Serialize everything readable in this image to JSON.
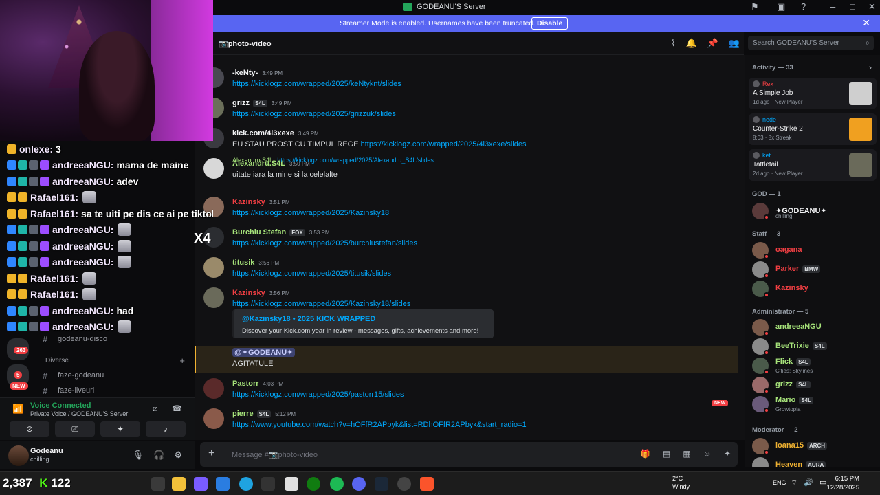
{
  "window": {
    "server_title": "GODEANU'S Server"
  },
  "banner": {
    "text": "Streamer Mode is enabled. Usernames have been truncated.",
    "button": "Disable"
  },
  "channel": {
    "name": "📷photo-video"
  },
  "search": {
    "placeholder": "Search GODEANU'S Server"
  },
  "stream_chat": [
    {
      "user": "onlexe:",
      "text": "3",
      "badges": [
        "gold"
      ]
    },
    {
      "user": "andreeaNGU:",
      "text": "mama de maine",
      "badges": [
        "blue",
        "teal",
        "grey",
        "purple"
      ]
    },
    {
      "user": "andreeaNGU:",
      "text": "adev",
      "badges": [
        "blue",
        "teal",
        "grey",
        "purple"
      ]
    },
    {
      "user": "Rafael161:",
      "text": "",
      "badges": [
        "gold",
        "gold"
      ],
      "emote": true
    },
    {
      "user": "Rafael161:",
      "text": "sa te uiti pe dis ce ai pe tiktoks",
      "badges": [
        "gold",
        "gold"
      ]
    },
    {
      "user": "andreeaNGU:",
      "text": "",
      "badges": [
        "blue",
        "teal",
        "grey",
        "purple"
      ],
      "emote": true
    },
    {
      "user": "andreeaNGU:",
      "text": "",
      "badges": [
        "blue",
        "teal",
        "grey",
        "purple"
      ],
      "emote": true
    },
    {
      "user": "andreeaNGU:",
      "text": "",
      "badges": [
        "blue",
        "teal",
        "grey",
        "purple"
      ],
      "emote": true
    },
    {
      "user": "Rafael161:",
      "text": "",
      "badges": [
        "gold",
        "gold"
      ],
      "emote": true
    },
    {
      "user": "Rafael161:",
      "text": "",
      "badges": [
        "gold",
        "gold"
      ],
      "emote": true
    },
    {
      "user": "andreeaNGU:",
      "text": "had",
      "badges": [
        "blue",
        "teal",
        "grey",
        "purple"
      ]
    },
    {
      "user": "andreeaNGU:",
      "text": "",
      "badges": [
        "blue",
        "teal",
        "grey",
        "purple"
      ],
      "emote": true
    }
  ],
  "channels": {
    "disco": "godeanu-disco",
    "category": "Diverse",
    "faze1": "faze-godeanu",
    "faze2": "faze-liveuri"
  },
  "guild_badges": {
    "b1": "263",
    "b2": "5",
    "new": "NEW"
  },
  "voice": {
    "title": "Voice Connected",
    "subtitle": "Private Voice / GODEANU'S Server"
  },
  "user": {
    "name": "Godeanu",
    "status": "chilling"
  },
  "messages": [
    {
      "author": "-keNty-",
      "time": "3:49 PM",
      "tag": "",
      "pre": "",
      "link": "https://kicklogz.com/wrapped/2025/keNtyknt/slides",
      "color": "#f2f3f5",
      "av": "#4a4a52"
    },
    {
      "author": "grizz",
      "time": "3:49 PM",
      "tag": "S4L",
      "pre": "",
      "link": "https://kicklogz.com/wrapped/2025/grizzuk/slides",
      "color": "#f2f3f5",
      "av": "#6b6f5a"
    },
    {
      "author": "kick.com/4l3xexe",
      "time": "3:49 PM",
      "tag": "",
      "pre": "EU STAU PROST CU TIMPUL REGE ",
      "link": "https://kicklogz.com/wrapped/2025/4l3xexe/slides",
      "color": "#f2f3f5",
      "av": "#3a3a40"
    },
    {
      "author": "Alexandru.S4L",
      "time": "3:50 PM",
      "tag": "",
      "pre": "uitate iara la mine si la celelalte",
      "link": "",
      "color": "#a6e27a",
      "av": "#d8d8d8"
    },
    {
      "author": "Kazinsky",
      "time": "3:51 PM",
      "tag": "",
      "pre": "",
      "link": "https://kicklogz.com/wrapped/2025/Kazinsky18",
      "color": "#f23f43",
      "av": "#8a6a5a"
    },
    {
      "author": "Burchiu Stefan",
      "time": "3:53 PM",
      "tag": "FOX",
      "pre": "",
      "link": "https://kicklogz.com/wrapped/2025/burchiustefan/slides",
      "color": "#a6e27a",
      "av": "#2b2d31"
    },
    {
      "author": "titusik",
      "time": "3:56 PM",
      "tag": "",
      "pre": "",
      "link": "https://kicklogz.com/wrapped/2025/titusik/slides",
      "color": "#a6e27a",
      "av": "#9a8a6a"
    },
    {
      "author": "Kazinsky",
      "time": "3:56 PM",
      "tag": "",
      "pre": "",
      "link": "https://kicklogz.com/wrapped/2025/Kazinsky18/slides",
      "color": "#f23f43",
      "av": "#6a6a5a"
    },
    {
      "author": "Pastorr",
      "time": "4:03 PM",
      "tag": "",
      "pre": "",
      "link": "https://kicklogz.com/wrapped/2025/pastorr15/slides",
      "color": "#a6e27a",
      "av": "#5a2a2a"
    },
    {
      "author": "pierre",
      "time": "5:12 PM",
      "tag": "S4L",
      "pre": "",
      "link": "https://www.youtube.com/watch?v=hOFfR2APbyk&list=RDhOFfR2APbyk&start_radio=1",
      "color": "#a6e27a",
      "av": "#8a5a4a"
    }
  ],
  "reply": {
    "author": "Alexandru.S4L",
    "link": "https://kicklogz.com/wrapped/2025/Alexandru_S4L/slides"
  },
  "embed": {
    "title": "@Kazinsky18 • 2025 KICK WRAPPED",
    "desc": "Discover your Kick.com year in review - messages, gifts, achievements and more!"
  },
  "mention": {
    "text": "@✦GODEANU✦",
    "body": "AGITATULE"
  },
  "new_label": "NEW",
  "composer": {
    "placeholder": "Message #📷photo-video"
  },
  "right": {
    "activity_header": "Activity — 33",
    "activities": [
      {
        "who": "Rex",
        "game": "A Simple Job",
        "meta": "1d ago · New Player",
        "thumb": "#cfcfcf"
      },
      {
        "who": "nede",
        "game": "Counter-Strike 2",
        "meta": "8:03 · 8x Streak",
        "thumb": "#f0a020"
      },
      {
        "who": "ket",
        "game": "Tattletail",
        "meta": "2d ago · New Player",
        "thumb": "#6a6a5a"
      }
    ],
    "god_header": "GOD — 1",
    "god": {
      "name": "✦GODEANU✦",
      "sub": "chilling"
    },
    "staff_header": "Staff — 3",
    "staff": [
      {
        "name": "oagana",
        "color": "#f23f43",
        "tag": ""
      },
      {
        "name": "Parker",
        "color": "#f23f43",
        "tag": "BMW"
      },
      {
        "name": "Kazinsky",
        "color": "#f23f43",
        "tag": ""
      }
    ],
    "admin_header": "Administrator — 5",
    "admins": [
      {
        "name": "andreeaNGU",
        "color": "#a6e27a",
        "tag": "",
        "sub": ""
      },
      {
        "name": "BeeTrixie",
        "color": "#a6e27a",
        "tag": "S4L",
        "sub": ""
      },
      {
        "name": "Flick",
        "color": "#a6e27a",
        "tag": "S4L",
        "sub": "Cities: Skylines"
      },
      {
        "name": "grizz",
        "color": "#a6e27a",
        "tag": "S4L",
        "sub": ""
      },
      {
        "name": "Mario",
        "color": "#a6e27a",
        "tag": "S4L",
        "sub": "Growtopia"
      }
    ],
    "mod_header": "Moderator — 2",
    "mods": [
      {
        "name": "loana15",
        "color": "#f0b232",
        "tag": "ARCH"
      },
      {
        "name": "Heaven",
        "color": "#f0b232",
        "tag": "AURA"
      }
    ]
  },
  "taskbar": {
    "temp": "2°C",
    "weather": "Windy",
    "lang": "ENG",
    "time": "6:15 PM",
    "date": "12/28/2025"
  },
  "overlay": {
    "viewers": "2,387",
    "kick": "122",
    "x4": "X4"
  }
}
